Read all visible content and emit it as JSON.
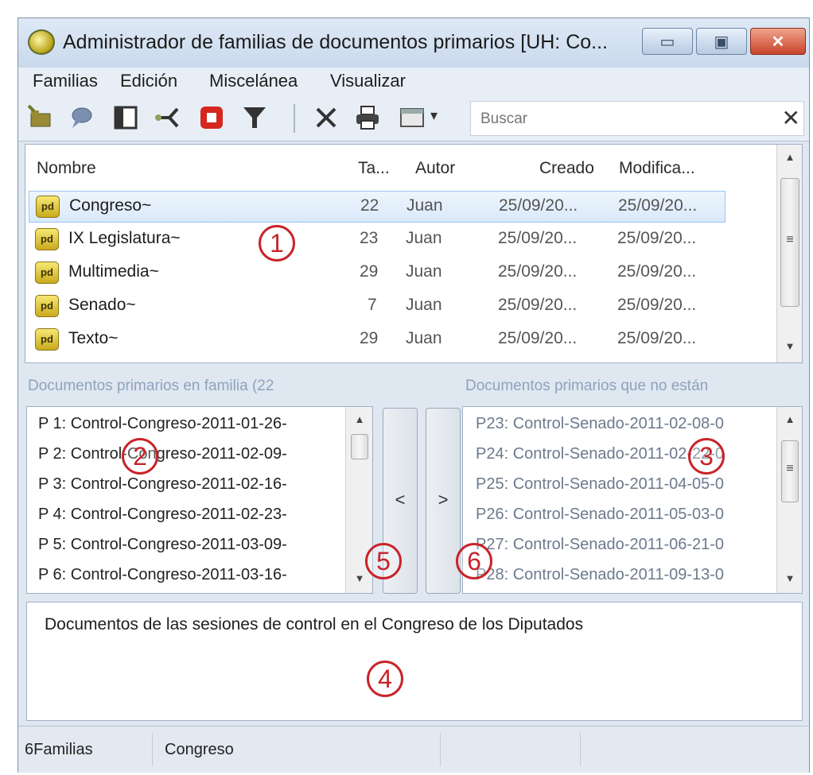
{
  "window": {
    "title": "Administrador de familias de documentos primarios [UH: Co...",
    "min_glyph": "▭",
    "max_glyph": "▣",
    "close_glyph": "✕"
  },
  "menu": [
    "Familias",
    "Edición",
    "Miscelánea",
    "Visualizar"
  ],
  "toolbar": {
    "icons": [
      "new-family-icon",
      "comment-icon",
      "panel-icon",
      "network-icon",
      "stop-icon",
      "filter-icon",
      "delete-icon",
      "print-icon",
      "view-icon"
    ],
    "search_placeholder": "Buscar",
    "clear_glyph": "✕",
    "dropdown_glyph": "▾"
  },
  "families_table": {
    "headers": {
      "name": "Nombre",
      "size": "Ta...",
      "author": "Autor",
      "created": "Creado",
      "modified": "Modifica..."
    },
    "rows": [
      {
        "name": "Congreso~",
        "size": "22",
        "author": "Juan",
        "created": "25/09/20...",
        "modified": "25/09/20...",
        "selected": true
      },
      {
        "name": "IX Legislatura~",
        "size": "23",
        "author": "Juan",
        "created": "25/09/20...",
        "modified": "25/09/20..."
      },
      {
        "name": "Multimedia~",
        "size": "29",
        "author": "Juan",
        "created": "25/09/20...",
        "modified": "25/09/20..."
      },
      {
        "name": "Senado~",
        "size": "7",
        "author": "Juan",
        "created": "25/09/20...",
        "modified": "25/09/20..."
      },
      {
        "name": "Texto~",
        "size": "29",
        "author": "Juan",
        "created": "25/09/20...",
        "modified": "25/09/20..."
      }
    ],
    "icon_text": "pd"
  },
  "left_panel": {
    "label": "Documentos primarios en familia (22",
    "items": [
      "P 1: Control-Congreso-2011-01-26-",
      "P 2: Control-Congreso-2011-02-09-",
      "P 3: Control-Congreso-2011-02-16-",
      "P 4: Control-Congreso-2011-02-23-",
      "P 5: Control-Congreso-2011-03-09-",
      "P 6: Control-Congreso-2011-03-16-"
    ]
  },
  "right_panel": {
    "label": "Documentos primarios que no están",
    "items": [
      "P23: Control-Senado-2011-02-08-0",
      "P24: Control-Senado-2011-02-22-0",
      "P25: Control-Senado-2011-04-05-0",
      "P26: Control-Senado-2011-05-03-0",
      "P27: Control-Senado-2011-06-21-0",
      "P28: Control-Senado-2011-09-13-0"
    ]
  },
  "buttons": {
    "remove": "<",
    "add": ">"
  },
  "description": "Documentos de las sesiones de control en el Congreso de los Diputados",
  "status": {
    "count": "6Familias",
    "current": "Congreso"
  },
  "callouts": [
    "1",
    "2",
    "3",
    "4",
    "5",
    "6"
  ],
  "scroll_arrows": {
    "up": "▲",
    "down": "▼",
    "grip": "≡"
  }
}
